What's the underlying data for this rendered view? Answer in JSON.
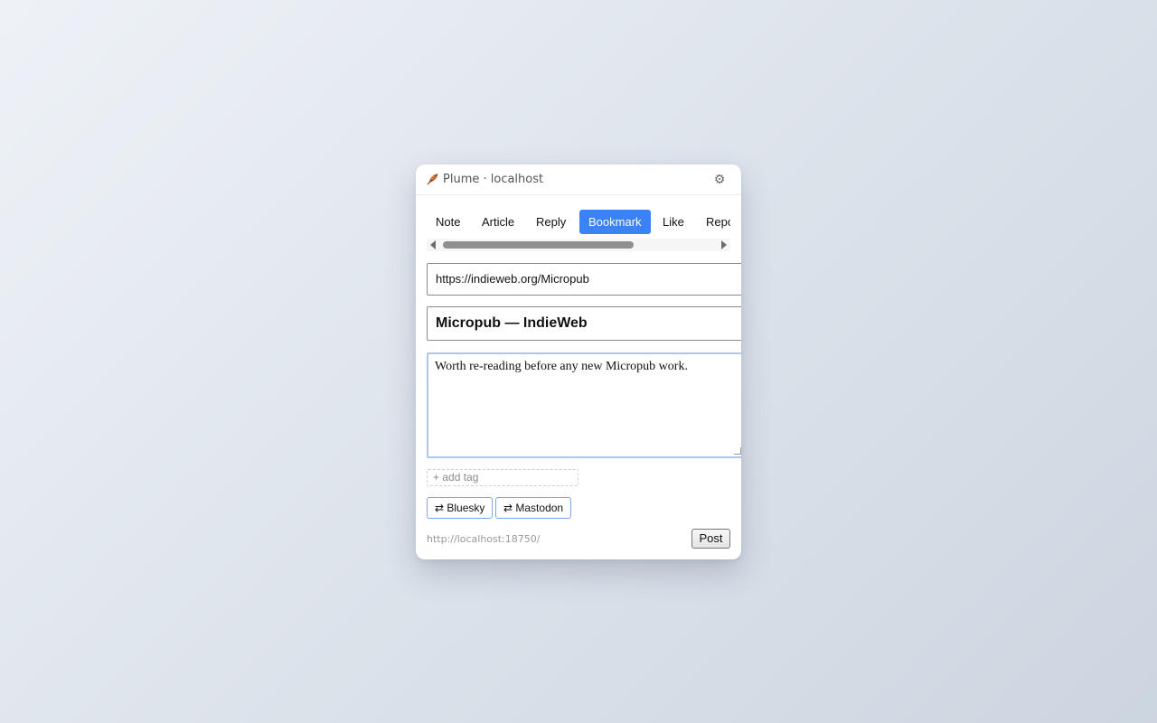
{
  "window": {
    "title": "Plume · localhost",
    "logo_icon": "feather-icon",
    "settings_icon": "gear-icon",
    "settings_glyph": "⚙"
  },
  "tabs": [
    {
      "label": "Note",
      "active": false
    },
    {
      "label": "Article",
      "active": false
    },
    {
      "label": "Reply",
      "active": false
    },
    {
      "label": "Bookmark",
      "active": true
    },
    {
      "label": "Like",
      "active": false
    },
    {
      "label": "Repost",
      "active": false
    }
  ],
  "form": {
    "bookmark_url": "https://indieweb.org/Micropub",
    "bookmark_title": "Micropub — IndieWeb",
    "content": "Worth re-reading before any new Micropub work.",
    "tag_placeholder": "+ add tag"
  },
  "syndication": [
    {
      "label": "⇄ Bluesky"
    },
    {
      "label": "⇄ Mastodon"
    }
  ],
  "footer": {
    "endpoint": "http://localhost:18750/",
    "post_label": "Post"
  },
  "colors": {
    "accent": "#3b82f6",
    "syndicate_border": "#7aa7ea",
    "focus_border": "#a9c8f3"
  }
}
